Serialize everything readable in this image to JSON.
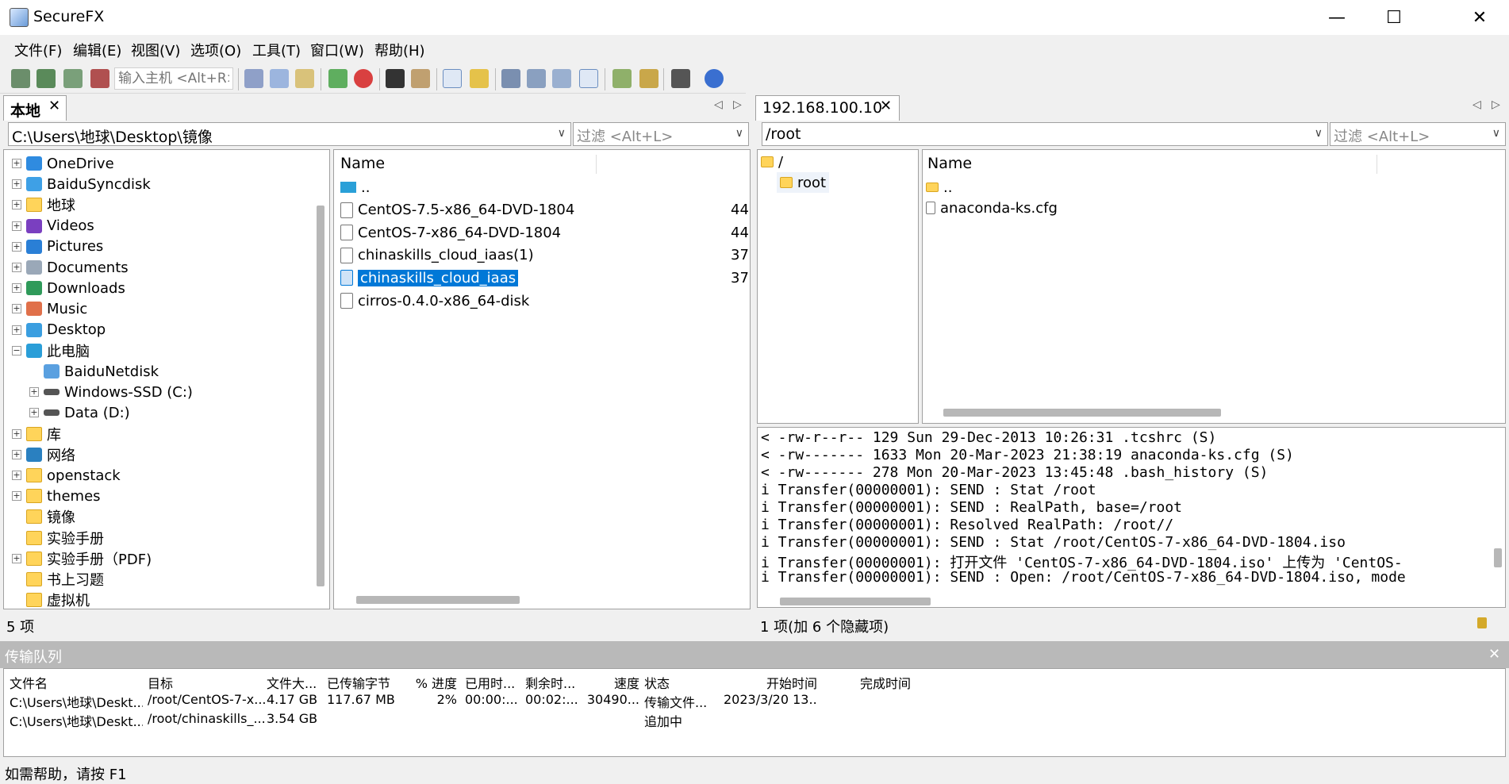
{
  "window": {
    "title": "SecureFX",
    "minimize": "—",
    "maximize": "☐",
    "close": "✕"
  },
  "menu": [
    "文件(F)",
    "编辑(E)",
    "视图(V)",
    "选项(O)",
    "工具(T)",
    "窗口(W)",
    "帮助(H)"
  ],
  "toolbar": {
    "host_placeholder": "输入主机 <Alt+R>"
  },
  "local": {
    "tab_label": "本地",
    "path": "C:\\Users\\地球\\Desktop\\镜像",
    "filter_placeholder": "过滤 <Alt+L>",
    "tree": [
      {
        "label": "OneDrive",
        "icon": "cloud-icon",
        "exp": "+"
      },
      {
        "label": "BaiduSyncdisk",
        "icon": "sync-icon",
        "exp": "+"
      },
      {
        "label": "地球",
        "icon": "folder-icon",
        "exp": "+"
      },
      {
        "label": "Videos",
        "icon": "video-icon",
        "exp": "+"
      },
      {
        "label": "Pictures",
        "icon": "picture-icon",
        "exp": "+"
      },
      {
        "label": "Documents",
        "icon": "document-icon",
        "exp": "+"
      },
      {
        "label": "Downloads",
        "icon": "download-icon",
        "exp": "+"
      },
      {
        "label": "Music",
        "icon": "music-icon",
        "exp": "+"
      },
      {
        "label": "Desktop",
        "icon": "desktop-icon",
        "exp": "+"
      },
      {
        "label": "此电脑",
        "icon": "computer-icon",
        "exp": "−"
      },
      {
        "label": "BaiduNetdisk",
        "icon": "netdisk-icon",
        "exp": "",
        "indent": 1
      },
      {
        "label": "Windows-SSD (C:)",
        "icon": "drive-icon",
        "exp": "+",
        "indent": 1
      },
      {
        "label": "Data (D:)",
        "icon": "drive-icon",
        "exp": "+",
        "indent": 1
      },
      {
        "label": "库",
        "icon": "folder-icon",
        "exp": "+"
      },
      {
        "label": "网络",
        "icon": "network-icon",
        "exp": "+"
      },
      {
        "label": "openstack",
        "icon": "folder-icon",
        "exp": "+"
      },
      {
        "label": "themes",
        "icon": "folder-icon",
        "exp": "+"
      },
      {
        "label": "镜像",
        "icon": "folder-icon",
        "exp": ""
      },
      {
        "label": "实验手册",
        "icon": "folder-icon",
        "exp": ""
      },
      {
        "label": "实验手册（PDF)",
        "icon": "folder-icon",
        "exp": "+"
      },
      {
        "label": "书上习题",
        "icon": "folder-icon",
        "exp": ""
      },
      {
        "label": "虚拟机",
        "icon": "folder-icon",
        "exp": ""
      }
    ],
    "list_header": "Name",
    "files": [
      {
        "name": "..",
        "size": ""
      },
      {
        "name": "CentOS-7.5-x86_64-DVD-1804",
        "size": "44"
      },
      {
        "name": "CentOS-7-x86_64-DVD-1804",
        "size": "44"
      },
      {
        "name": "chinaskills_cloud_iaas(1)",
        "size": "37"
      },
      {
        "name": "chinaskills_cloud_iaas",
        "size": "37"
      },
      {
        "name": "cirros-0.4.0-x86_64-disk",
        "size": ""
      }
    ],
    "status": "5 项"
  },
  "remote": {
    "tab_label": "192.168.100.10",
    "path": "/root",
    "filter_placeholder": "过滤 <Alt+L>",
    "tree_root": "/",
    "tree_child": "root",
    "list_header": "Name",
    "files": [
      {
        "name": ".."
      },
      {
        "name": "anaconda-ks.cfg"
      }
    ],
    "log": [
      "< -rw-r--r--      129 Sun 29-Dec-2013 10:26:31 .tcshrc (S)",
      "< -rw-------     1633 Mon 20-Mar-2023 21:38:19 anaconda-ks.cfg (S)",
      "< -rw-------      278 Mon 20-Mar-2023 13:45:48 .bash_history (S)",
      "i Transfer(00000001): SEND : Stat /root",
      "i Transfer(00000001): SEND : RealPath, base=/root",
      "i Transfer(00000001): Resolved RealPath: /root//",
      "i Transfer(00000001): SEND : Stat /root/CentOS-7-x86_64-DVD-1804.iso",
      "i Transfer(00000001): 打开文件 'CentOS-7-x86_64-DVD-1804.iso' 上传为 'CentOS-",
      "i Transfer(00000001): SEND : Open: /root/CentOS-7-x86_64-DVD-1804.iso, mode"
    ],
    "status": "1 项(加 6 个隐藏项)"
  },
  "queue": {
    "title": "传输队列",
    "close": "✕",
    "headers": [
      "文件名",
      "目标",
      "文件大...",
      "已传输字节",
      "% 进度",
      "已用时...",
      "剩余时...",
      "速度",
      "状态",
      "开始时间",
      "完成时间"
    ],
    "rows": [
      [
        "C:\\Users\\地球\\Deskt...",
        "/root/CentOS-7-x...",
        "4.17 GB",
        "117.67 MB",
        "2%",
        "00:00:...",
        "00:02:...",
        "30490...",
        "传输文件...",
        "2023/3/20 13...",
        ""
      ],
      [
        "C:\\Users\\地球\\Deskt...",
        "/root/chinaskills_...",
        "3.54 GB",
        "",
        "",
        "",
        "",
        "",
        "追加中",
        "",
        ""
      ]
    ]
  },
  "statusbar": {
    "help": "如需帮助，请按 F1"
  }
}
